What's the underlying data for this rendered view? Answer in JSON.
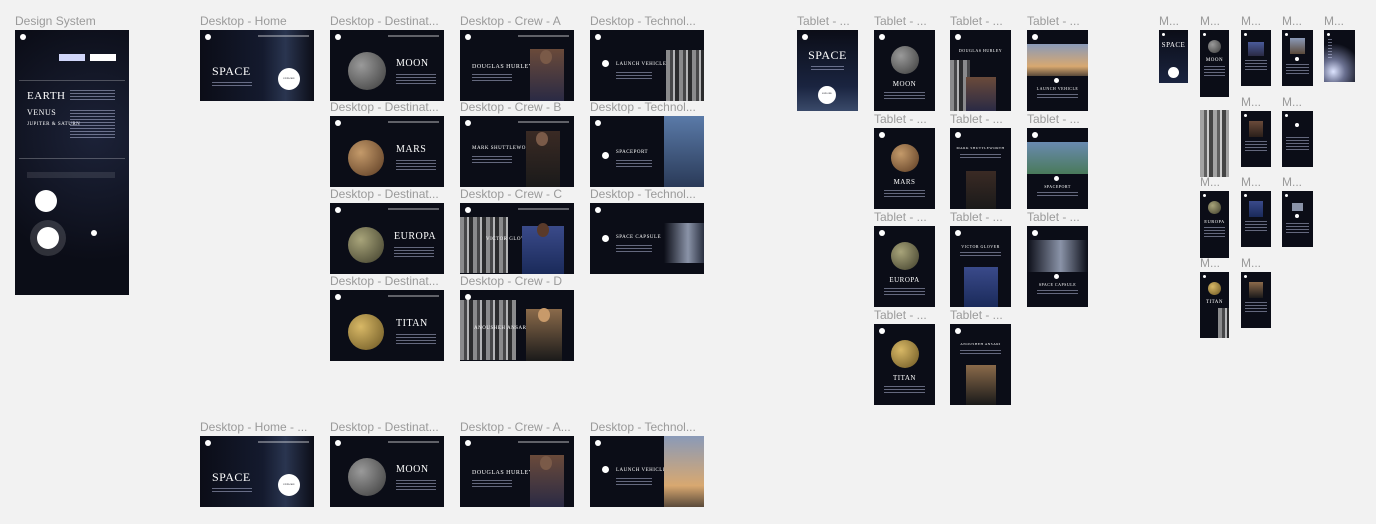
{
  "canvas": {
    "background": "#f2f2f2",
    "frame_background": "#0b0d17",
    "accent_light": "#d0d6f9"
  },
  "design_system": {
    "label": "Design System",
    "words": [
      "EARTH",
      "VENUS",
      "JUPITER & SATURN"
    ]
  },
  "home": {
    "label": "Desktop - Home",
    "title": "SPACE",
    "button": "EXPLORE"
  },
  "home_alt": {
    "label": "Desktop - Home - ...",
    "title": "SPACE",
    "button": "EXPLORE"
  },
  "destinations": [
    {
      "label": "Desktop - Destinat...",
      "name": "MOON"
    },
    {
      "label": "Desktop - Destinat...",
      "name": "MARS"
    },
    {
      "label": "Desktop - Destinat...",
      "name": "EUROPA"
    },
    {
      "label": "Desktop - Destinat...",
      "name": "TITAN"
    },
    {
      "label": "Desktop - Destinat...",
      "name": "MOON"
    }
  ],
  "crew": [
    {
      "label": "Desktop - Crew - A",
      "name": "DOUGLAS HURLEY"
    },
    {
      "label": "Desktop - Crew - B",
      "name": "MARK SHUTTLEWORTH"
    },
    {
      "label": "Desktop - Crew - C",
      "name": "VICTOR GLOVER"
    },
    {
      "label": "Desktop - Crew - D",
      "name": "ANOUSHEH ANSARI"
    },
    {
      "label": "Desktop - Crew - A...",
      "name": "DOUGLAS HURLEY"
    }
  ],
  "technology": [
    {
      "label": "Desktop - Technol...",
      "name": "LAUNCH VEHICLE"
    },
    {
      "label": "Desktop - Technol...",
      "name": "SPACEPORT"
    },
    {
      "label": "Desktop - Technol...",
      "name": "SPACE CAPSULE"
    },
    {
      "label": "Desktop - Technol...",
      "name": "LAUNCH VEHICLE"
    }
  ],
  "tablet": {
    "home": {
      "label": "Tablet - ...",
      "title": "SPACE",
      "button": "EXPLORE"
    },
    "destinations": [
      {
        "label": "Tablet - ...",
        "name": "MOON"
      },
      {
        "label": "Tablet - ...",
        "name": "MARS"
      },
      {
        "label": "Tablet - ...",
        "name": "EUROPA"
      },
      {
        "label": "Tablet - ...",
        "name": "TITAN"
      }
    ],
    "crew": [
      {
        "label": "Tablet - ...",
        "name": "DOUGLAS HURLEY"
      },
      {
        "label": "Tablet - ...",
        "name": "MARK SHUTTLEWORTH"
      },
      {
        "label": "Tablet - ...",
        "name": "VICTOR GLOVER"
      },
      {
        "label": "Tablet - ...",
        "name": "ANOUSHEH ANSARI"
      }
    ],
    "technology": [
      {
        "label": "Tablet - ...",
        "name": "LAUNCH VEHICLE"
      },
      {
        "label": "Tablet - ...",
        "name": "SPACEPORT"
      },
      {
        "label": "Tablet - ...",
        "name": "SPACE CAPSULE"
      }
    ]
  },
  "mobile": {
    "label": "M...",
    "home_title": "SPACE",
    "destinations": [
      "MOON",
      "EUROPA",
      "TITAN"
    ]
  }
}
